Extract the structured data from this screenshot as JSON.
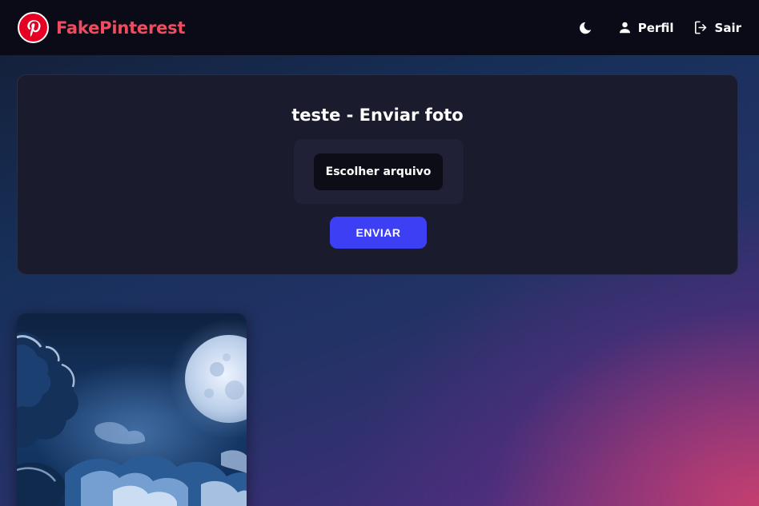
{
  "navbar": {
    "brand": "FakePinterest",
    "theme_toggle_icon": "moon-icon",
    "profile_label": "Perfil",
    "profile_icon": "user-icon",
    "logout_label": "Sair",
    "logout_icon": "logout-icon"
  },
  "upload": {
    "title": "teste - Enviar foto",
    "file_button_label": "Escolher arquivo",
    "submit_label": "ENVIAR"
  },
  "gallery": {
    "photos": [
      {
        "subject": "full moon over blue clouds at night"
      }
    ]
  },
  "colors": {
    "brand": "#e60023",
    "brand_text": "#ef4d5f",
    "navbar_bg": "#0b0b17",
    "card_bg": "#1b1b2e",
    "submit_bg": "#3d3ff5"
  }
}
